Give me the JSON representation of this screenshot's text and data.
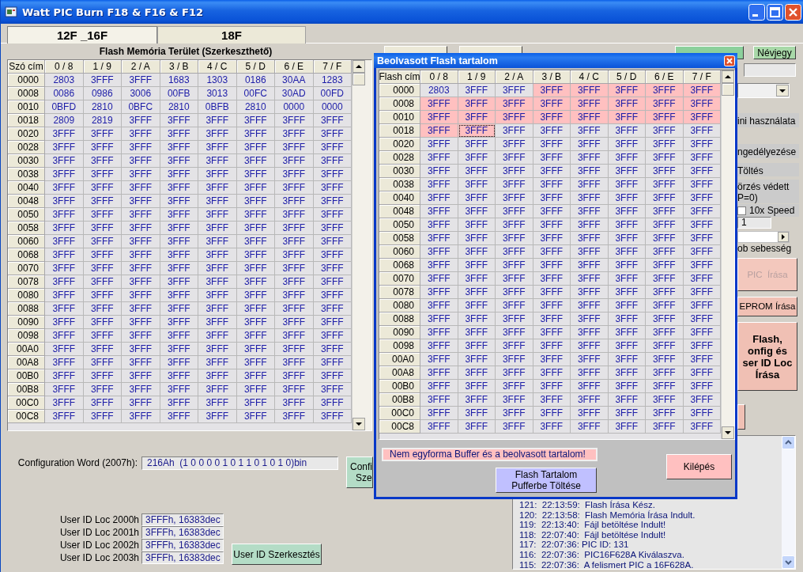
{
  "window": {
    "title": "Watt PIC Burn F18 & F16 & F12"
  },
  "tabs": [
    {
      "label": "12F _16F",
      "selected": true
    },
    {
      "label": "18F",
      "selected": false
    }
  ],
  "flash_grid": {
    "title": "Flash Memória Terület (Szerkeszthető)",
    "address_header": "Szó cím",
    "columns": [
      "0 / 8",
      "1 / 9",
      "2 / A",
      "3 / B",
      "4 / C",
      "5 / D",
      "6 / E",
      "7 / F"
    ],
    "rows": [
      {
        "address": "0000",
        "cells": [
          "2803",
          "3FFF",
          "3FFF",
          "1683",
          "1303",
          "0186",
          "30AA",
          "1283"
        ]
      },
      {
        "address": "0008",
        "cells": [
          "0086",
          "0986",
          "3006",
          "00FB",
          "3013",
          "00FC",
          "30AD",
          "00FD"
        ]
      },
      {
        "address": "0010",
        "cells": [
          "0BFD",
          "2810",
          "0BFC",
          "2810",
          "0BFB",
          "2810",
          "0000",
          "0000"
        ]
      },
      {
        "address": "0018",
        "cells": [
          "2809",
          "2819",
          "3FFF",
          "3FFF",
          "3FFF",
          "3FFF",
          "3FFF",
          "3FFF"
        ]
      },
      {
        "address": "0020",
        "cells": [
          "3FFF",
          "3FFF",
          "3FFF",
          "3FFF",
          "3FFF",
          "3FFF",
          "3FFF",
          "3FFF"
        ]
      },
      {
        "address": "0028",
        "cells": [
          "3FFF",
          "3FFF",
          "3FFF",
          "3FFF",
          "3FFF",
          "3FFF",
          "3FFF",
          "3FFF"
        ]
      },
      {
        "address": "0030",
        "cells": [
          "3FFF",
          "3FFF",
          "3FFF",
          "3FFF",
          "3FFF",
          "3FFF",
          "3FFF",
          "3FFF"
        ]
      },
      {
        "address": "0038",
        "cells": [
          "3FFF",
          "3FFF",
          "3FFF",
          "3FFF",
          "3FFF",
          "3FFF",
          "3FFF",
          "3FFF"
        ]
      },
      {
        "address": "0040",
        "cells": [
          "3FFF",
          "3FFF",
          "3FFF",
          "3FFF",
          "3FFF",
          "3FFF",
          "3FFF",
          "3FFF"
        ]
      },
      {
        "address": "0048",
        "cells": [
          "3FFF",
          "3FFF",
          "3FFF",
          "3FFF",
          "3FFF",
          "3FFF",
          "3FFF",
          "3FFF"
        ]
      },
      {
        "address": "0050",
        "cells": [
          "3FFF",
          "3FFF",
          "3FFF",
          "3FFF",
          "3FFF",
          "3FFF",
          "3FFF",
          "3FFF"
        ]
      },
      {
        "address": "0058",
        "cells": [
          "3FFF",
          "3FFF",
          "3FFF",
          "3FFF",
          "3FFF",
          "3FFF",
          "3FFF",
          "3FFF"
        ]
      },
      {
        "address": "0060",
        "cells": [
          "3FFF",
          "3FFF",
          "3FFF",
          "3FFF",
          "3FFF",
          "3FFF",
          "3FFF",
          "3FFF"
        ]
      },
      {
        "address": "0068",
        "cells": [
          "3FFF",
          "3FFF",
          "3FFF",
          "3FFF",
          "3FFF",
          "3FFF",
          "3FFF",
          "3FFF"
        ]
      },
      {
        "address": "0070",
        "cells": [
          "3FFF",
          "3FFF",
          "3FFF",
          "3FFF",
          "3FFF",
          "3FFF",
          "3FFF",
          "3FFF"
        ]
      },
      {
        "address": "0078",
        "cells": [
          "3FFF",
          "3FFF",
          "3FFF",
          "3FFF",
          "3FFF",
          "3FFF",
          "3FFF",
          "3FFF"
        ]
      },
      {
        "address": "0080",
        "cells": [
          "3FFF",
          "3FFF",
          "3FFF",
          "3FFF",
          "3FFF",
          "3FFF",
          "3FFF",
          "3FFF"
        ]
      },
      {
        "address": "0088",
        "cells": [
          "3FFF",
          "3FFF",
          "3FFF",
          "3FFF",
          "3FFF",
          "3FFF",
          "3FFF",
          "3FFF"
        ]
      },
      {
        "address": "0090",
        "cells": [
          "3FFF",
          "3FFF",
          "3FFF",
          "3FFF",
          "3FFF",
          "3FFF",
          "3FFF",
          "3FFF"
        ]
      },
      {
        "address": "0098",
        "cells": [
          "3FFF",
          "3FFF",
          "3FFF",
          "3FFF",
          "3FFF",
          "3FFF",
          "3FFF",
          "3FFF"
        ]
      },
      {
        "address": "00A0",
        "cells": [
          "3FFF",
          "3FFF",
          "3FFF",
          "3FFF",
          "3FFF",
          "3FFF",
          "3FFF",
          "3FFF"
        ]
      },
      {
        "address": "00A8",
        "cells": [
          "3FFF",
          "3FFF",
          "3FFF",
          "3FFF",
          "3FFF",
          "3FFF",
          "3FFF",
          "3FFF"
        ]
      },
      {
        "address": "00B0",
        "cells": [
          "3FFF",
          "3FFF",
          "3FFF",
          "3FFF",
          "3FFF",
          "3FFF",
          "3FFF",
          "3FFF"
        ]
      },
      {
        "address": "00B8",
        "cells": [
          "3FFF",
          "3FFF",
          "3FFF",
          "3FFF",
          "3FFF",
          "3FFF",
          "3FFF",
          "3FFF"
        ]
      },
      {
        "address": "00C0",
        "cells": [
          "3FFF",
          "3FFF",
          "3FFF",
          "3FFF",
          "3FFF",
          "3FFF",
          "3FFF",
          "3FFF"
        ]
      },
      {
        "address": "00C8",
        "cells": [
          "3FFF",
          "3FFF",
          "3FFF",
          "3FFF",
          "3FFF",
          "3FFF",
          "3FFF",
          "3FFF"
        ]
      }
    ]
  },
  "config_word": {
    "label": "Configuration Word (2007h):",
    "value": "216Ah  (1 0 0 0 0 1 0 1 1 0 1 0 1 0)bin"
  },
  "config_button": {
    "lines": [
      "Confi",
      "Sze"
    ]
  },
  "user_ids": [
    {
      "label": "User ID Loc 2000h",
      "value": "3FFFh, 16383dec"
    },
    {
      "label": "User ID Loc 2001h",
      "value": "3FFFh, 16383dec"
    },
    {
      "label": "User ID Loc 2002h",
      "value": "3FFFh, 16383dec"
    },
    {
      "label": "User ID Loc 2003h",
      "value": "3FFFh, 16383dec"
    }
  ],
  "user_id_button": "User ID Szerkesztés",
  "about_button": "Névjegy",
  "right_panel": [
    {
      "kind": "field"
    },
    {
      "kind": "dropdown"
    },
    {
      "kind": "label",
      "text": "ini használata"
    },
    {
      "kind": "label",
      "text": "ngedélyezése"
    },
    {
      "kind": "label",
      "text": "Töltés"
    },
    {
      "kind": "label",
      "text": "örzés védett\nP=0)"
    },
    {
      "kind": "checkbox",
      "text": "10x Speed",
      "checked": false
    },
    {
      "kind": "field",
      "value": "1"
    },
    {
      "kind": "scrollbar"
    },
    {
      "kind": "note",
      "text": "ob sebesség"
    },
    {
      "kind": "button",
      "text": "PIC  Írása",
      "disabled": true
    },
    {
      "kind": "button",
      "text": "EPROM Írása",
      "disabled": false
    },
    {
      "kind": "button",
      "text": "Flash,\nonfig és\nser ID Loc\nÍrása",
      "disabled": false,
      "bold": true
    },
    {
      "kind": "button"
    }
  ],
  "log": [
    "121:  22:13:59:  Flash Írása Kész.",
    "120:  22:13:58:  Flash Memória Írása Indult.",
    "119:  22:13:40:  Fájl betöltése Indult!",
    "118:  22:07:40:  Fájl betöltése Indult!",
    "117:  22:07:36: PIC ID: 131",
    "116:  22:07:36:  PIC16F628A Kiválaszva.",
    "115:  22:07:36:  A felismert PIC a 16F628A."
  ],
  "dialog": {
    "title": "Beolvasott Flash tartalom",
    "address_header": "Flash cím",
    "columns": [
      "0 / 8",
      "1 / 9",
      "2 / A",
      "3 / B",
      "4 / C",
      "5 / D",
      "6 / E",
      "7 / F"
    ],
    "rows": [
      {
        "address": "0000",
        "cells": [
          "2803",
          "3FFF",
          "3FFF",
          "3FFF",
          "3FFF",
          "3FFF",
          "3FFF",
          "3FFF"
        ],
        "mismatch": [
          false,
          false,
          false,
          true,
          true,
          true,
          true,
          true
        ],
        "selected": [
          false,
          false,
          false,
          false,
          false,
          false,
          false,
          false
        ]
      },
      {
        "address": "0008",
        "cells": [
          "3FFF",
          "3FFF",
          "3FFF",
          "3FFF",
          "3FFF",
          "3FFF",
          "3FFF",
          "3FFF"
        ],
        "mismatch": [
          true,
          true,
          true,
          true,
          true,
          true,
          true,
          true
        ],
        "selected": [
          false,
          false,
          false,
          false,
          false,
          false,
          false,
          false
        ]
      },
      {
        "address": "0010",
        "cells": [
          "3FFF",
          "3FFF",
          "3FFF",
          "3FFF",
          "3FFF",
          "3FFF",
          "3FFF",
          "3FFF"
        ],
        "mismatch": [
          true,
          true,
          true,
          true,
          true,
          true,
          true,
          true
        ],
        "selected": [
          false,
          false,
          false,
          false,
          false,
          false,
          false,
          false
        ]
      },
      {
        "address": "0018",
        "cells": [
          "3FFF",
          "3FFF",
          "3FFF",
          "3FFF",
          "3FFF",
          "3FFF",
          "3FFF",
          "3FFF"
        ],
        "mismatch": [
          true,
          true,
          false,
          false,
          false,
          false,
          false,
          false
        ],
        "selected": [
          false,
          true,
          false,
          false,
          false,
          false,
          false,
          false
        ]
      },
      {
        "address": "0020",
        "cells": [
          "3FFF",
          "3FFF",
          "3FFF",
          "3FFF",
          "3FFF",
          "3FFF",
          "3FFF",
          "3FFF"
        ],
        "mismatch": [
          false,
          false,
          false,
          false,
          false,
          false,
          false,
          false
        ],
        "selected": [
          false,
          false,
          false,
          false,
          false,
          false,
          false,
          false
        ]
      },
      {
        "address": "0028",
        "cells": [
          "3FFF",
          "3FFF",
          "3FFF",
          "3FFF",
          "3FFF",
          "3FFF",
          "3FFF",
          "3FFF"
        ],
        "mismatch": [
          false,
          false,
          false,
          false,
          false,
          false,
          false,
          false
        ],
        "selected": [
          false,
          false,
          false,
          false,
          false,
          false,
          false,
          false
        ]
      },
      {
        "address": "0030",
        "cells": [
          "3FFF",
          "3FFF",
          "3FFF",
          "3FFF",
          "3FFF",
          "3FFF",
          "3FFF",
          "3FFF"
        ],
        "mismatch": [
          false,
          false,
          false,
          false,
          false,
          false,
          false,
          false
        ],
        "selected": [
          false,
          false,
          false,
          false,
          false,
          false,
          false,
          false
        ]
      },
      {
        "address": "0038",
        "cells": [
          "3FFF",
          "3FFF",
          "3FFF",
          "3FFF",
          "3FFF",
          "3FFF",
          "3FFF",
          "3FFF"
        ],
        "mismatch": [
          false,
          false,
          false,
          false,
          false,
          false,
          false,
          false
        ],
        "selected": [
          false,
          false,
          false,
          false,
          false,
          false,
          false,
          false
        ]
      },
      {
        "address": "0040",
        "cells": [
          "3FFF",
          "3FFF",
          "3FFF",
          "3FFF",
          "3FFF",
          "3FFF",
          "3FFF",
          "3FFF"
        ],
        "mismatch": [
          false,
          false,
          false,
          false,
          false,
          false,
          false,
          false
        ],
        "selected": [
          false,
          false,
          false,
          false,
          false,
          false,
          false,
          false
        ]
      },
      {
        "address": "0048",
        "cells": [
          "3FFF",
          "3FFF",
          "3FFF",
          "3FFF",
          "3FFF",
          "3FFF",
          "3FFF",
          "3FFF"
        ],
        "mismatch": [
          false,
          false,
          false,
          false,
          false,
          false,
          false,
          false
        ],
        "selected": [
          false,
          false,
          false,
          false,
          false,
          false,
          false,
          false
        ]
      },
      {
        "address": "0050",
        "cells": [
          "3FFF",
          "3FFF",
          "3FFF",
          "3FFF",
          "3FFF",
          "3FFF",
          "3FFF",
          "3FFF"
        ],
        "mismatch": [
          false,
          false,
          false,
          false,
          false,
          false,
          false,
          false
        ],
        "selected": [
          false,
          false,
          false,
          false,
          false,
          false,
          false,
          false
        ]
      },
      {
        "address": "0058",
        "cells": [
          "3FFF",
          "3FFF",
          "3FFF",
          "3FFF",
          "3FFF",
          "3FFF",
          "3FFF",
          "3FFF"
        ],
        "mismatch": [
          false,
          false,
          false,
          false,
          false,
          false,
          false,
          false
        ],
        "selected": [
          false,
          false,
          false,
          false,
          false,
          false,
          false,
          false
        ]
      },
      {
        "address": "0060",
        "cells": [
          "3FFF",
          "3FFF",
          "3FFF",
          "3FFF",
          "3FFF",
          "3FFF",
          "3FFF",
          "3FFF"
        ],
        "mismatch": [
          false,
          false,
          false,
          false,
          false,
          false,
          false,
          false
        ],
        "selected": [
          false,
          false,
          false,
          false,
          false,
          false,
          false,
          false
        ]
      },
      {
        "address": "0068",
        "cells": [
          "3FFF",
          "3FFF",
          "3FFF",
          "3FFF",
          "3FFF",
          "3FFF",
          "3FFF",
          "3FFF"
        ],
        "mismatch": [
          false,
          false,
          false,
          false,
          false,
          false,
          false,
          false
        ],
        "selected": [
          false,
          false,
          false,
          false,
          false,
          false,
          false,
          false
        ]
      },
      {
        "address": "0070",
        "cells": [
          "3FFF",
          "3FFF",
          "3FFF",
          "3FFF",
          "3FFF",
          "3FFF",
          "3FFF",
          "3FFF"
        ],
        "mismatch": [
          false,
          false,
          false,
          false,
          false,
          false,
          false,
          false
        ],
        "selected": [
          false,
          false,
          false,
          false,
          false,
          false,
          false,
          false
        ]
      },
      {
        "address": "0078",
        "cells": [
          "3FFF",
          "3FFF",
          "3FFF",
          "3FFF",
          "3FFF",
          "3FFF",
          "3FFF",
          "3FFF"
        ],
        "mismatch": [
          false,
          false,
          false,
          false,
          false,
          false,
          false,
          false
        ],
        "selected": [
          false,
          false,
          false,
          false,
          false,
          false,
          false,
          false
        ]
      },
      {
        "address": "0080",
        "cells": [
          "3FFF",
          "3FFF",
          "3FFF",
          "3FFF",
          "3FFF",
          "3FFF",
          "3FFF",
          "3FFF"
        ],
        "mismatch": [
          false,
          false,
          false,
          false,
          false,
          false,
          false,
          false
        ],
        "selected": [
          false,
          false,
          false,
          false,
          false,
          false,
          false,
          false
        ]
      },
      {
        "address": "0088",
        "cells": [
          "3FFF",
          "3FFF",
          "3FFF",
          "3FFF",
          "3FFF",
          "3FFF",
          "3FFF",
          "3FFF"
        ],
        "mismatch": [
          false,
          false,
          false,
          false,
          false,
          false,
          false,
          false
        ],
        "selected": [
          false,
          false,
          false,
          false,
          false,
          false,
          false,
          false
        ]
      },
      {
        "address": "0090",
        "cells": [
          "3FFF",
          "3FFF",
          "3FFF",
          "3FFF",
          "3FFF",
          "3FFF",
          "3FFF",
          "3FFF"
        ],
        "mismatch": [
          false,
          false,
          false,
          false,
          false,
          false,
          false,
          false
        ],
        "selected": [
          false,
          false,
          false,
          false,
          false,
          false,
          false,
          false
        ]
      },
      {
        "address": "0098",
        "cells": [
          "3FFF",
          "3FFF",
          "3FFF",
          "3FFF",
          "3FFF",
          "3FFF",
          "3FFF",
          "3FFF"
        ],
        "mismatch": [
          false,
          false,
          false,
          false,
          false,
          false,
          false,
          false
        ],
        "selected": [
          false,
          false,
          false,
          false,
          false,
          false,
          false,
          false
        ]
      },
      {
        "address": "00A0",
        "cells": [
          "3FFF",
          "3FFF",
          "3FFF",
          "3FFF",
          "3FFF",
          "3FFF",
          "3FFF",
          "3FFF"
        ],
        "mismatch": [
          false,
          false,
          false,
          false,
          false,
          false,
          false,
          false
        ],
        "selected": [
          false,
          false,
          false,
          false,
          false,
          false,
          false,
          false
        ]
      },
      {
        "address": "00A8",
        "cells": [
          "3FFF",
          "3FFF",
          "3FFF",
          "3FFF",
          "3FFF",
          "3FFF",
          "3FFF",
          "3FFF"
        ],
        "mismatch": [
          false,
          false,
          false,
          false,
          false,
          false,
          false,
          false
        ],
        "selected": [
          false,
          false,
          false,
          false,
          false,
          false,
          false,
          false
        ]
      },
      {
        "address": "00B0",
        "cells": [
          "3FFF",
          "3FFF",
          "3FFF",
          "3FFF",
          "3FFF",
          "3FFF",
          "3FFF",
          "3FFF"
        ],
        "mismatch": [
          false,
          false,
          false,
          false,
          false,
          false,
          false,
          false
        ],
        "selected": [
          false,
          false,
          false,
          false,
          false,
          false,
          false,
          false
        ]
      },
      {
        "address": "00B8",
        "cells": [
          "3FFF",
          "3FFF",
          "3FFF",
          "3FFF",
          "3FFF",
          "3FFF",
          "3FFF",
          "3FFF"
        ],
        "mismatch": [
          false,
          false,
          false,
          false,
          false,
          false,
          false,
          false
        ],
        "selected": [
          false,
          false,
          false,
          false,
          false,
          false,
          false,
          false
        ]
      },
      {
        "address": "00C0",
        "cells": [
          "3FFF",
          "3FFF",
          "3FFF",
          "3FFF",
          "3FFF",
          "3FFF",
          "3FFF",
          "3FFF"
        ],
        "mismatch": [
          false,
          false,
          false,
          false,
          false,
          false,
          false,
          false
        ],
        "selected": [
          false,
          false,
          false,
          false,
          false,
          false,
          false,
          false
        ]
      },
      {
        "address": "00C8",
        "cells": [
          "3FFF",
          "3FFF",
          "3FFF",
          "3FFF",
          "3FFF",
          "3FFF",
          "3FFF",
          "3FFF"
        ],
        "mismatch": [
          false,
          false,
          false,
          false,
          false,
          false,
          false,
          false
        ],
        "selected": [
          false,
          false,
          false,
          false,
          false,
          false,
          false,
          false
        ]
      }
    ],
    "message": "Nem egyforma Buffer és a beolvasott tartalom!",
    "load_button": "Flash Tartalom Pufferbe Töltése",
    "exit_button": "Kilépés"
  }
}
